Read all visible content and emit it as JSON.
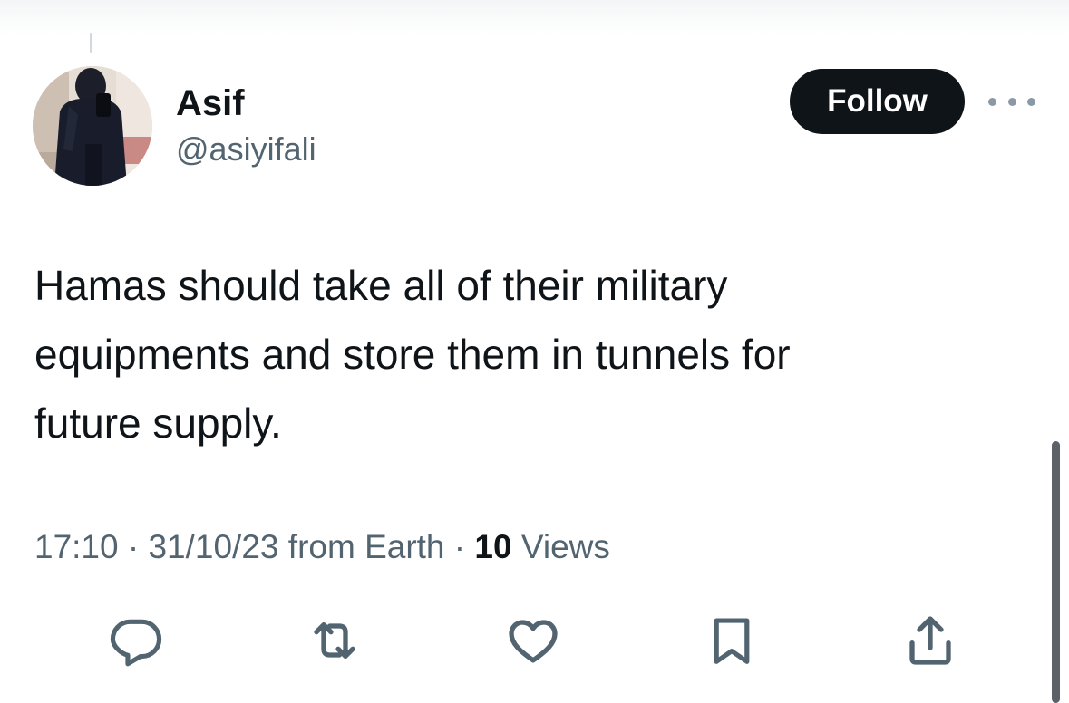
{
  "thread": {
    "connector": true
  },
  "author": {
    "display_name": "Asif",
    "handle": "@asiyifali",
    "avatar_icon": "profile-photo"
  },
  "header": {
    "follow_label": "Follow",
    "more_icon": "more-horizontal-icon"
  },
  "tweet": {
    "lines": [
      "Hamas should take all of their military",
      "equipments and store them in tunnels for",
      "future supply."
    ]
  },
  "meta": {
    "time": "17:10",
    "separator1": " · ",
    "date": "31/10/23",
    "source": " from Earth",
    "separator2": " · ",
    "views_count": "10",
    "views_label": " Views"
  },
  "actions": [
    {
      "name": "reply",
      "icon": "reply-icon"
    },
    {
      "name": "retweet",
      "icon": "retweet-icon"
    },
    {
      "name": "like",
      "icon": "like-icon"
    },
    {
      "name": "bookmark",
      "icon": "bookmark-icon"
    },
    {
      "name": "share",
      "icon": "share-icon"
    }
  ],
  "colors": {
    "text_primary": "#0f1419",
    "text_secondary": "#536471",
    "follow_bg": "#0f1419",
    "follow_text": "#ffffff"
  }
}
